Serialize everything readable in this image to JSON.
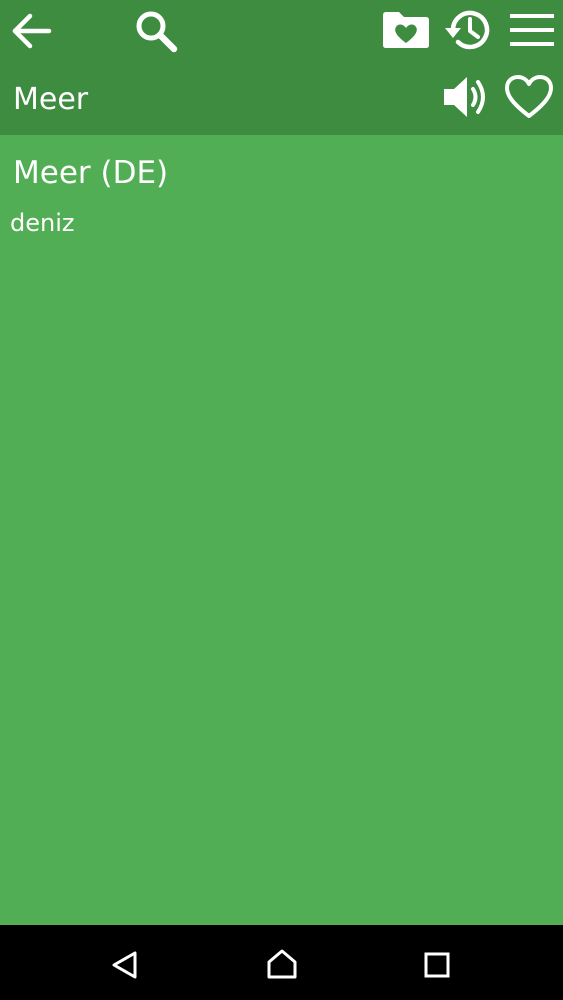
{
  "header": {
    "word": "Meer",
    "icons": {
      "back": "arrow-left-icon",
      "search": "search-icon",
      "favorites_folder": "folder-heart-icon",
      "history": "history-icon",
      "menu": "menu-icon",
      "speaker": "speaker-icon",
      "favorite": "heart-outline-icon"
    }
  },
  "entry": {
    "title": "Meer (DE)",
    "translation": "deniz"
  },
  "navbar": {
    "icons": [
      "back-triangle-icon",
      "home-icon",
      "recents-icon"
    ]
  },
  "colors": {
    "header": "#3d8c40",
    "content": "#52ae54",
    "navbar": "#000000",
    "text": "#ffffff"
  }
}
